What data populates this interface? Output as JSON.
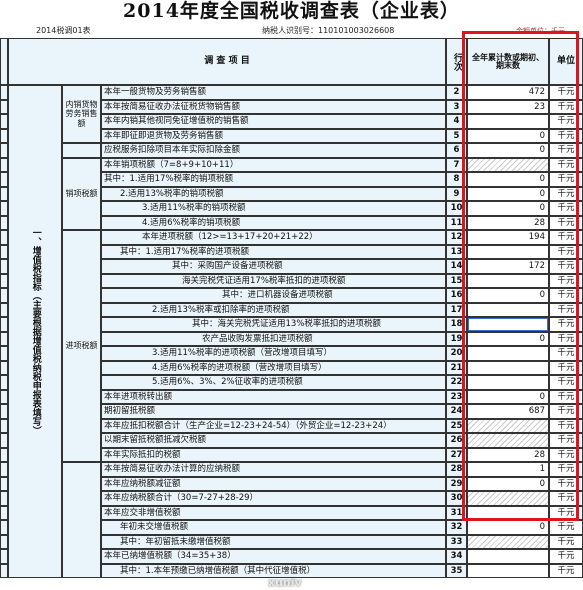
{
  "title": "2014年度全国税收调查表（企业表）",
  "form_code": "2014税调01表",
  "taxpayer_id": "纳税人识别号：110101003026608",
  "unit_note": "金额单位：千元",
  "watermark": "xuniv",
  "headers": {
    "item": "调 查 项 目",
    "line": "行次",
    "amount": "全年累计数或期初、期末数",
    "unit": "单位"
  },
  "section_main": "一、增值税指标（主要根据增值税纳税申报表填写）",
  "groups": {
    "domestic_sales": "内销货物劳务销售额",
    "output_tax": "销项税额",
    "input_tax": "进项税额"
  },
  "rows": [
    {
      "label": "本年一般货物及劳务销售额",
      "line": "2",
      "value": "472",
      "unit": "千元"
    },
    {
      "label": "本年按简易征收办法征税货物销售额",
      "line": "3",
      "value": "23",
      "unit": "千元"
    },
    {
      "label": "本年内销其他视同免征增值税的销售额",
      "line": "4",
      "value": "",
      "unit": "千元"
    },
    {
      "label": "本年即征即退货物及劳务销售额",
      "line": "5",
      "value": "0",
      "unit": "千元"
    },
    {
      "label": "应税服务扣除项目本年实际扣除金额",
      "line": "6",
      "value": "0",
      "unit": "千元"
    },
    {
      "label": "本年销项税额（7=8+9+10+11）",
      "line": "7",
      "value": "",
      "unit": "千元"
    },
    {
      "label": "其中：1.适用17%税率的销项税额",
      "line": "8",
      "value": "0",
      "unit": "千元"
    },
    {
      "label": "2.适用13%税率的销项税额",
      "line": "9",
      "value": "0",
      "unit": "千元"
    },
    {
      "label": "3.适用11%税率的销项税额",
      "line": "10",
      "value": "0",
      "unit": "千元"
    },
    {
      "label": "4.适用6%税率的销项税额",
      "line": "11",
      "value": "28",
      "unit": "千元"
    },
    {
      "label": "本年进项税额（12>=13+17+20+21+22）",
      "line": "12",
      "value": "194",
      "unit": "千元"
    },
    {
      "label": "其中：1.适用17%税率的进项税额",
      "line": "13",
      "value": "",
      "unit": "千元"
    },
    {
      "label": "其中：采购国产设备进项税额",
      "line": "14",
      "value": "172",
      "unit": "千元"
    },
    {
      "label": "海关完税凭证适用17%税率抵扣的进项税额",
      "line": "15",
      "value": "",
      "unit": "千元"
    },
    {
      "label": "其中：进口机器设备进项税额",
      "line": "16",
      "value": "0",
      "unit": "千元"
    },
    {
      "label": "2.适用13%税率或扣除率的进项税额",
      "line": "17",
      "value": "",
      "unit": "千元"
    },
    {
      "label": "其中：海关完税凭证适用13%税率抵扣的进项税额",
      "line": "18",
      "value": "",
      "unit": "千元"
    },
    {
      "label": "农产品收购发票抵扣进项税额",
      "line": "19",
      "value": "0",
      "unit": "千元"
    },
    {
      "label": "3.适用11%税率的进项税额（营改增项目填写）",
      "line": "20",
      "value": "",
      "unit": "千元"
    },
    {
      "label": "4.适用6%税率的进项税额（营改增项目填写）",
      "line": "21",
      "value": "",
      "unit": "千元"
    },
    {
      "label": "5.适用6%、3%、2%征收率的进项税额",
      "line": "22",
      "value": "",
      "unit": "千元"
    },
    {
      "label": "本年进项税转出额",
      "line": "23",
      "value": "0",
      "unit": "千元"
    },
    {
      "label": "期初留抵税额",
      "line": "24",
      "value": "687",
      "unit": "千元"
    },
    {
      "label": "本年应抵扣税额合计（生产企业=12-23+24-54）（外贸企业=12-23+24）",
      "line": "25",
      "value": "",
      "unit": "千元"
    },
    {
      "label": "以期末留抵税额抵减欠税额",
      "line": "26",
      "value": "",
      "unit": "千元"
    },
    {
      "label": "本年实际抵扣的税额",
      "line": "27",
      "value": "28",
      "unit": "千元"
    },
    {
      "label": "本年按简易征收办法计算的应纳税额",
      "line": "28",
      "value": "1",
      "unit": "千元"
    },
    {
      "label": "本年应纳税额减征额",
      "line": "29",
      "value": "0",
      "unit": "千元"
    },
    {
      "label": "本年应纳税额合计（30=7-27+28-29）",
      "line": "30",
      "value": "",
      "unit": "千元"
    },
    {
      "label": "本年应交非增值税额",
      "line": "31",
      "value": "",
      "unit": "千元"
    },
    {
      "label": "年初未交增值税额",
      "line": "32",
      "value": "0",
      "unit": "千元"
    },
    {
      "label": "其中：年初留抵未缴增值税额",
      "line": "33",
      "value": "",
      "unit": "千元"
    },
    {
      "label": "本年已纳增值税额（34=35+38）",
      "line": "34",
      "value": "",
      "unit": "千元"
    },
    {
      "label": "其中：1.本年预缴已纳增值税额（其中代征增值税）",
      "line": "35",
      "value": "",
      "unit": "千元"
    }
  ]
}
